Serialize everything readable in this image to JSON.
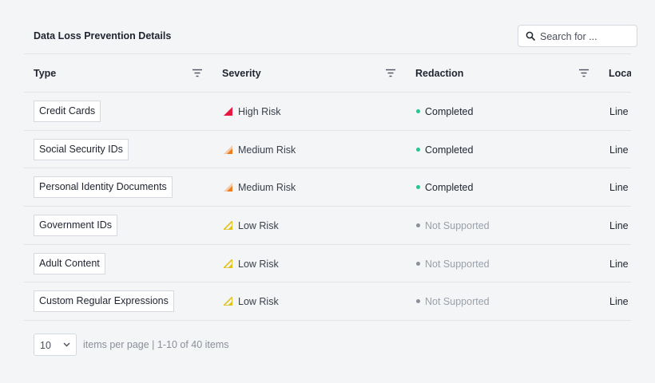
{
  "header": {
    "title": "Data Loss Prevention Details",
    "search_placeholder": "Search for ..."
  },
  "columns": {
    "type": "Type",
    "severity": "Severity",
    "redaction": "Redaction",
    "location": "Locat"
  },
  "rows": [
    {
      "type": "Credit Cards",
      "severity": "High Risk",
      "severity_level": "high",
      "redaction": "Completed",
      "redaction_status": "completed",
      "location": "Line C"
    },
    {
      "type": "Social Security IDs",
      "severity": "Medium Risk",
      "severity_level": "medium",
      "redaction": "Completed",
      "redaction_status": "completed",
      "location": "Line C"
    },
    {
      "type": "Personal Identity Documents",
      "severity": "Medium Risk",
      "severity_level": "medium",
      "redaction": "Completed",
      "redaction_status": "completed",
      "location": "Line C"
    },
    {
      "type": "Government IDs",
      "severity": "Low Risk",
      "severity_level": "low",
      "redaction": "Not Supported",
      "redaction_status": "not-supported",
      "location": "Line C"
    },
    {
      "type": "Adult Content",
      "severity": "Low Risk",
      "severity_level": "low",
      "redaction": "Not Supported",
      "redaction_status": "not-supported",
      "location": "Line C"
    },
    {
      "type": "Custom Regular Expressions",
      "severity": "Low Risk",
      "severity_level": "low",
      "redaction": "Not Supported",
      "redaction_status": "not-supported",
      "location": "Line C"
    }
  ],
  "footer": {
    "page_size": "10",
    "info": "items per page  |  1-10 of 40 items"
  },
  "colors": {
    "high": "#e8173f",
    "medium": "#f07c1b",
    "low": "#e3c11b",
    "completed": "#1ec98f",
    "not_supported": "#8a8f99",
    "completed_text": "#1f2430",
    "not_supported_text": "#9aa0aa"
  },
  "icons": {
    "search": "search-icon",
    "filter": "filter-icon",
    "severity": "severity-triangle-icon",
    "dropdown": "chevron-down-icon"
  }
}
